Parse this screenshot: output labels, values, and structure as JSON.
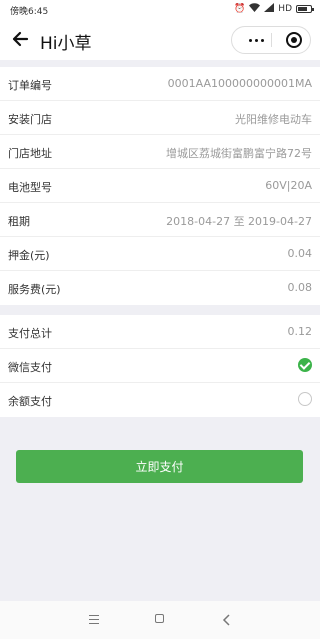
{
  "status_bar": {
    "time": "傍晚6:45",
    "network": "HD"
  },
  "nav": {
    "title": "Hi小草"
  },
  "order": [
    {
      "label": "订单编号",
      "value": "0001AA100000000001MA"
    },
    {
      "label": "安装门店",
      "value": "光阳维修电动车"
    },
    {
      "label": "门店地址",
      "value": "增城区荔城街富鹏富宁路72号"
    },
    {
      "label": "电池型号",
      "value": "60V|20A"
    },
    {
      "label": "租期",
      "value": "2018-04-27 至 2019-04-27"
    },
    {
      "label": "押金(元)",
      "value": "0.04"
    },
    {
      "label": "服务费(元)",
      "value": "0.08"
    }
  ],
  "payment": {
    "total_label": "支付总计",
    "total_value": "0.12",
    "wechat_label": "微信支付",
    "wechat_selected": true,
    "balance_label": "余额支付",
    "balance_selected": false
  },
  "pay_button": "立即支付",
  "colors": {
    "accent_green": "#4caf50",
    "background": "#efeff4"
  }
}
